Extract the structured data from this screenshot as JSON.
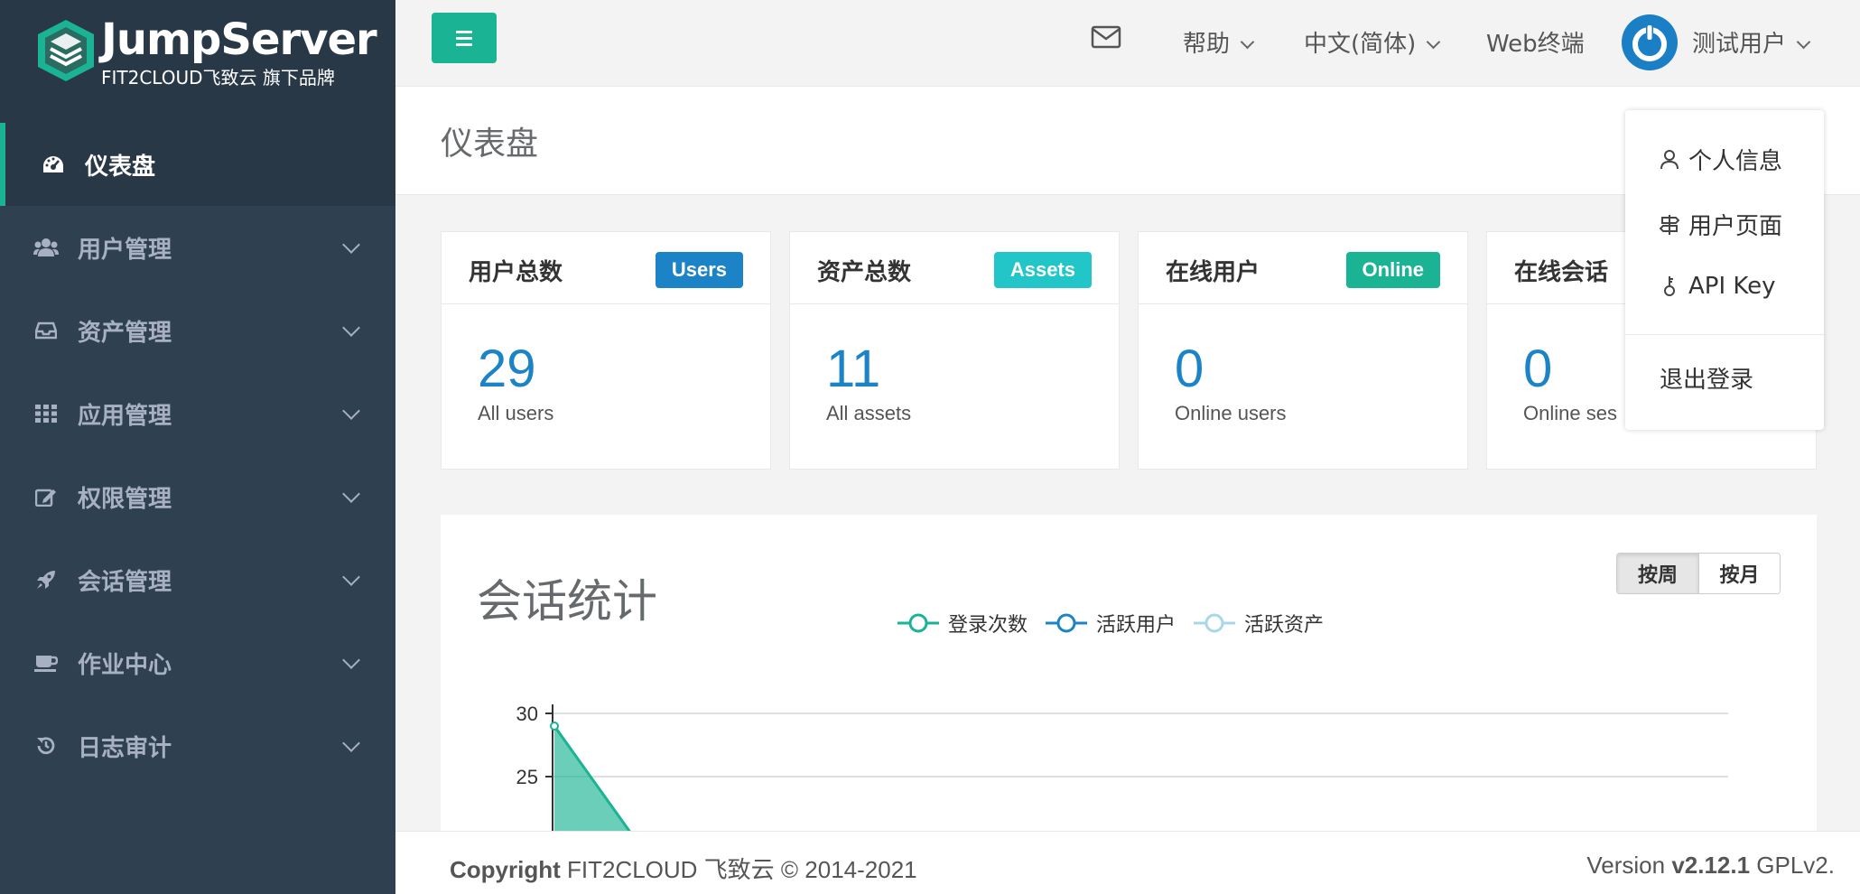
{
  "brand": {
    "name": "JumpServer",
    "subtitle": "FIT2CLOUD飞致云 旗下品牌",
    "accent": "#1ab394"
  },
  "sidebar": {
    "items": [
      {
        "label": "仪表盘",
        "icon": "dashboard-icon",
        "active": true
      },
      {
        "label": "用户管理",
        "icon": "users-icon"
      },
      {
        "label": "资产管理",
        "icon": "inbox-icon"
      },
      {
        "label": "应用管理",
        "icon": "grid-icon"
      },
      {
        "label": "权限管理",
        "icon": "edit-icon"
      },
      {
        "label": "会话管理",
        "icon": "rocket-icon"
      },
      {
        "label": "作业中心",
        "icon": "coffee-icon"
      },
      {
        "label": "日志审计",
        "icon": "history-icon"
      }
    ]
  },
  "topbar": {
    "help": "帮助",
    "language": "中文(简体)",
    "web_terminal": "Web终端",
    "user_name": "测试用户"
  },
  "user_menu": {
    "profile": "个人信息",
    "user_page": "用户页面",
    "api_key": "API Key",
    "logout": "退出登录"
  },
  "page": {
    "title": "仪表盘"
  },
  "stats": [
    {
      "title": "用户总数",
      "badge": "Users",
      "badge_color": "#1c84c6",
      "value": "29",
      "caption": "All users"
    },
    {
      "title": "资产总数",
      "badge": "Assets",
      "badge_color": "#23c6c8",
      "value": "11",
      "caption": "All assets"
    },
    {
      "title": "在线用户",
      "badge": "Online",
      "badge_color": "#1ab394",
      "value": "0",
      "caption": "Online users"
    },
    {
      "title": "在线会话",
      "badge": "",
      "badge_color": "#1ab394",
      "value": "0",
      "caption": "Online ses"
    }
  ],
  "session_chart": {
    "heading": "会话统计",
    "toggle_week": "按周",
    "toggle_month": "按月"
  },
  "chart_data": {
    "type": "area",
    "legend": [
      {
        "name": "登录次数",
        "color": "#1ab394"
      },
      {
        "name": "活跃用户",
        "color": "#1c84c6"
      },
      {
        "name": "活跃资产",
        "color": "#a8d8e8"
      }
    ],
    "yticks": [
      "30",
      "25"
    ],
    "ylim_visible": [
      20,
      30
    ],
    "series": [
      {
        "name": "登录次数",
        "values": [
          29
        ]
      }
    ]
  },
  "footer": {
    "copyright_bold": "Copyright",
    "copyright_rest": " FIT2CLOUD 飞致云 © 2014-2021",
    "version_label": "Version ",
    "version_value": "v2.12.1",
    "license": " GPLv2."
  }
}
